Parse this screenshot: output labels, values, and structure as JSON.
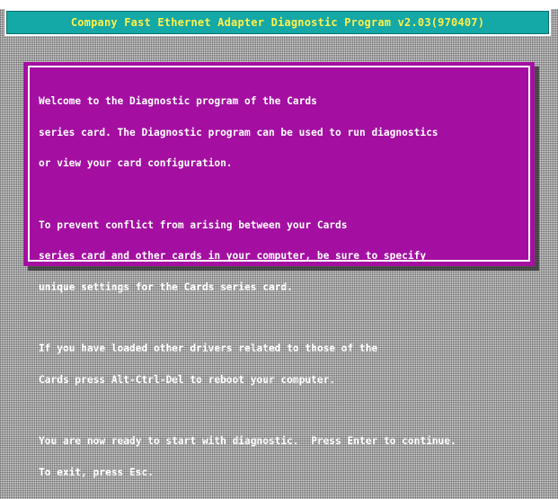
{
  "title_bar": {
    "text": "Company Fast Ethernet Adapter Diagnostic Program v2.03(970407)"
  },
  "dialog": {
    "paragraphs": [
      [
        "Welcome to the Diagnostic program of the Cards",
        "series card. The Diagnostic program can be used to run diagnostics",
        "or view your card configuration."
      ],
      [
        "To prevent conflict from arising between your Cards",
        "series card and other cards in your computer, be sure to specify",
        "unique settings for the Cards series card."
      ],
      [
        "If you have loaded other drivers related to those of the",
        "Cards press Alt-Ctrl-Del to reboot your computer."
      ],
      [
        "You are now ready to start with diagnostic.  Press Enter to continue.",
        "To exit, press Esc."
      ]
    ]
  },
  "colors": {
    "title_bg": "#14a8a6",
    "title_text": "#fff04a",
    "dialog_bg": "#a40fa2",
    "dialog_text": "#ffffff"
  }
}
